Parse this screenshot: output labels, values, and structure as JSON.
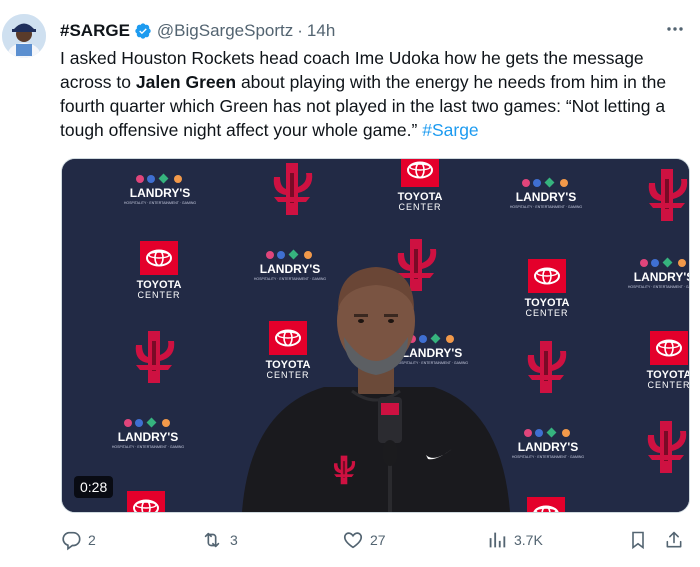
{
  "author": {
    "display_name": "#SARGE",
    "handle": "@BigSargeSportz",
    "separator": "·",
    "time": "14h",
    "avatar_icon": "user-avatar",
    "verified_icon": "verified-badge-icon"
  },
  "tweet": {
    "text_part1": "I asked Houston Rockets head coach Ime Udoka how he gets the message across to ",
    "bold_name": "Jalen Green",
    "text_part2": " about playing with the energy he needs from him in the fourth quarter which Green has not played in the last two games: “Not letting a tough offensive night affect your whole game.” ",
    "hashtag": "#Sarge"
  },
  "media": {
    "duration": "0:28",
    "backdrop": {
      "sponsor_text": "LANDRY'S",
      "sponsor_tagline": "HOSPITALITY · ENTERTAINMENT · GAMING",
      "venue_line1": "TOYOTA",
      "venue_line2": "CENTER"
    }
  },
  "actions": {
    "reply_count": "2",
    "retweet_count": "3",
    "like_count": "27",
    "views_count": "3.7K"
  },
  "colors": {
    "accent": "#1d9bf0",
    "muted": "#536471",
    "backdrop_navy": "#1f2740",
    "rockets_red": "#ce1141"
  }
}
